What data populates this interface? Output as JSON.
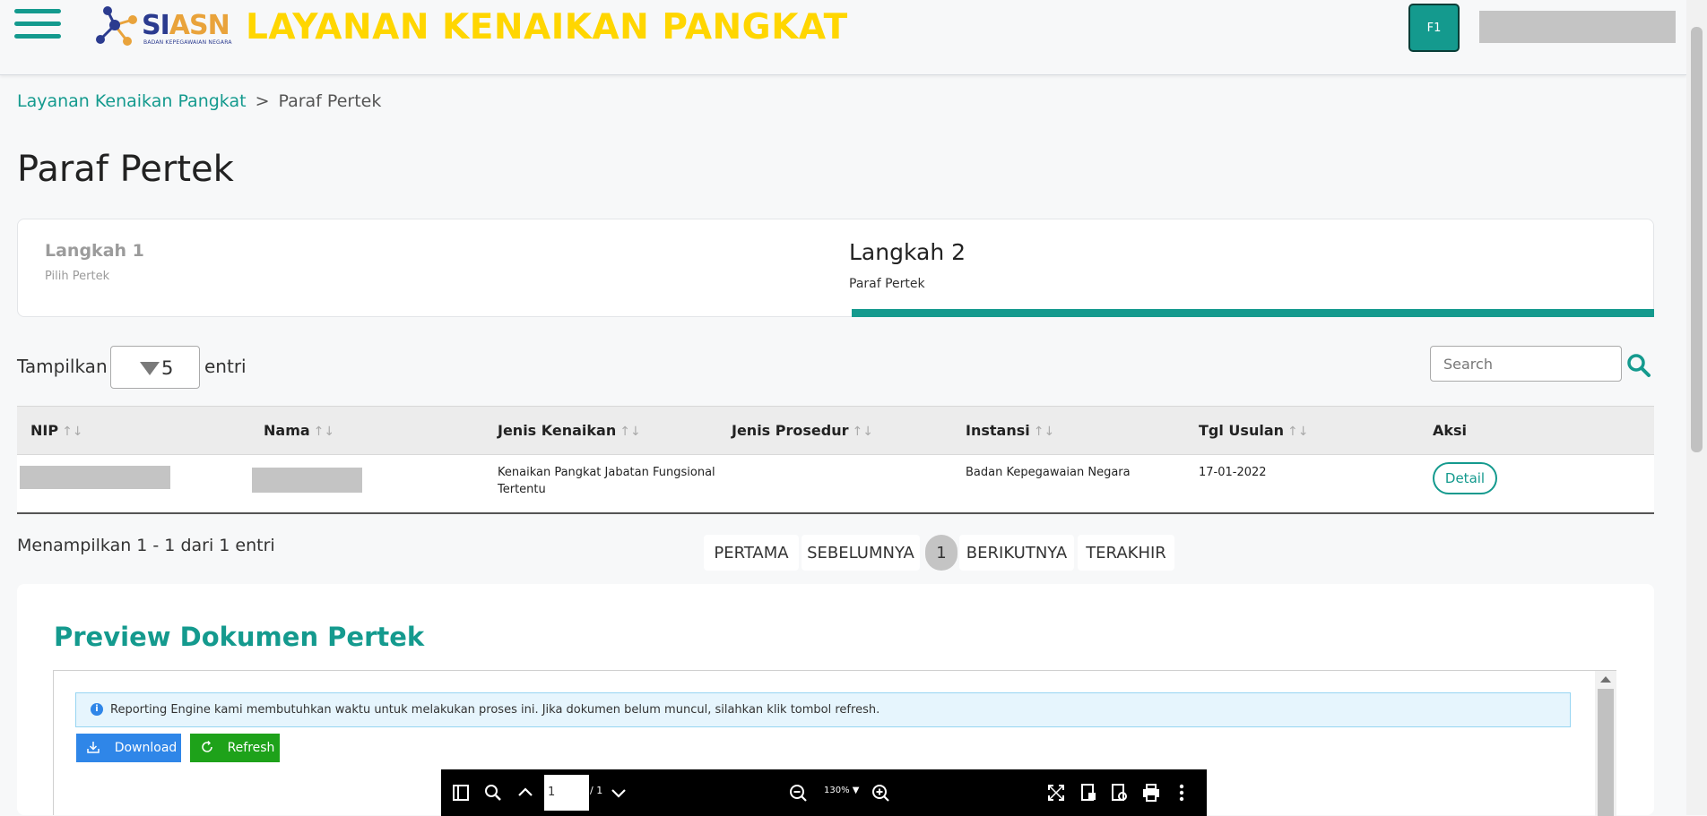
{
  "header": {
    "logo_main_1": "SI",
    "logo_main_2": "ASN",
    "logo_sub": "BADAN KEPEGAWAIAN NEGARA",
    "app_title": "LAYANAN KENAIKAN PANGKAT",
    "f1_label": "F1"
  },
  "breadcrumb": {
    "root": "Layanan Kenaikan Pangkat",
    "separator": ">",
    "current": "Paraf Pertek"
  },
  "page_title": "Paraf Pertek",
  "steps": [
    {
      "title": "Langkah 1",
      "subtitle": "Pilih Pertek",
      "state": "completed"
    },
    {
      "title": "Langkah 2",
      "subtitle": "Paraf Pertek",
      "state": "active"
    }
  ],
  "entries": {
    "show_label": "Tampilkan",
    "value": "5",
    "suffix": "entri"
  },
  "search": {
    "placeholder": "Search"
  },
  "table": {
    "columns": [
      "NIP",
      "Nama",
      "Jenis Kenaikan",
      "Jenis Prosedur",
      "Instansi",
      "Tgl Usulan",
      "Aksi"
    ],
    "sort_glyph": "↑↓",
    "rows": [
      {
        "jenis_kenaikan_1": "Kenaikan Pangkat Jabatan Fungsional",
        "jenis_kenaikan_2": "Tertentu",
        "jenis_prosedur": "",
        "instansi": "Badan Kepegawaian Negara",
        "tgl_usulan": "17-01-2022",
        "aksi": "Detail"
      }
    ]
  },
  "info": "Menampilkan 1 - 1 dari 1 entri",
  "pagination": {
    "first": "PERTAMA",
    "prev": "SEBELUMNYA",
    "current": "1",
    "next": "BERIKUTNYA",
    "last": "TERAKHIR"
  },
  "preview": {
    "title": "Preview Dokumen Pertek",
    "alert": "Reporting Engine kami membutuhkan waktu untuk melakukan proses ini. Jika dokumen belum muncul, silahkan klik tombol refresh.",
    "download_label": "Download",
    "refresh_label": "Refresh",
    "pdf": {
      "page": "1",
      "total": "/ 1",
      "zoom": "130% ▼"
    }
  },
  "colors": {
    "primary": "#149a8e",
    "title_yellow": "#ffd600",
    "download_blue": "#2f86e8",
    "refresh_green": "#1ea21a"
  },
  "icons": [
    "hamburger-menu-icon",
    "search-icon",
    "info-icon",
    "download-icon",
    "refresh-icon",
    "sidebar-toggle-icon",
    "zoom-search-icon",
    "page-up-icon",
    "page-down-icon",
    "zoom-out-icon",
    "zoom-in-icon",
    "fullscreen-icon",
    "document-properties-icon",
    "document-export-icon",
    "print-icon",
    "more-vertical-icon"
  ]
}
